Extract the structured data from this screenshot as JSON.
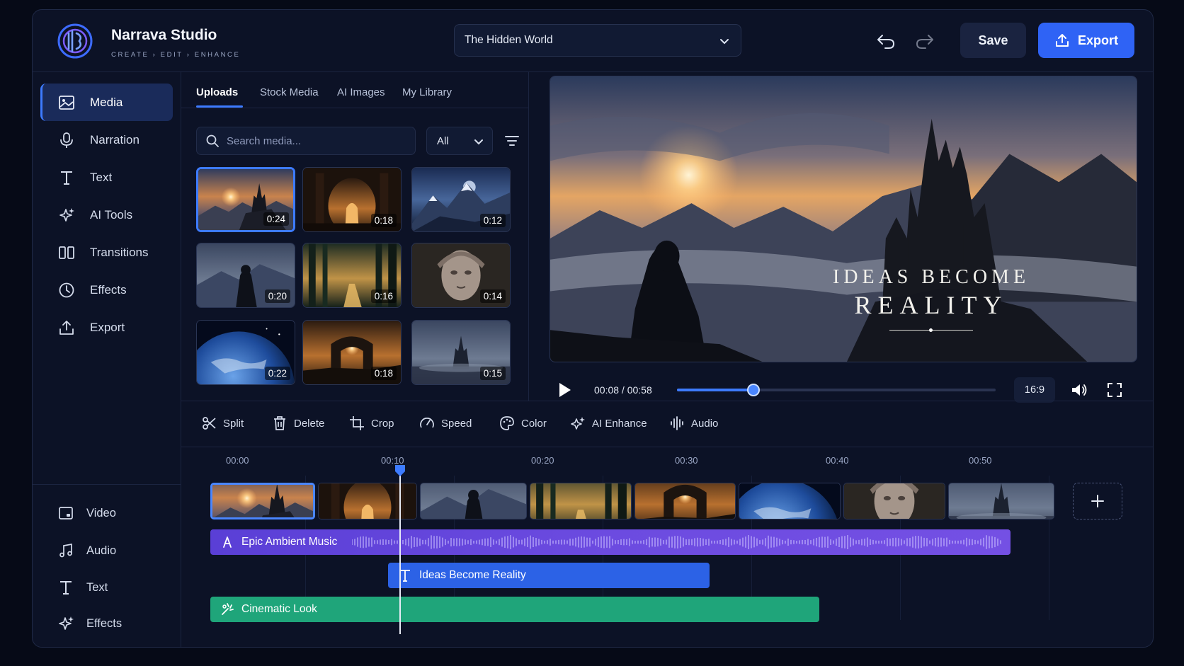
{
  "app": {
    "title": "Narrava Studio",
    "subtitle": "CREATE › EDIT › ENHANCE",
    "project": "The Hidden World",
    "save_label": "Save",
    "export_label": "Export"
  },
  "sidebar": {
    "items": [
      {
        "label": "Media",
        "icon": "image-icon",
        "active": true
      },
      {
        "label": "Narration",
        "icon": "microphone-icon"
      },
      {
        "label": "Text",
        "icon": "text-icon"
      },
      {
        "label": "AI Tools",
        "icon": "sparkle-icon"
      },
      {
        "label": "Transitions",
        "icon": "transitions-icon"
      },
      {
        "label": "Effects",
        "icon": "effects-icon"
      },
      {
        "label": "Export",
        "icon": "upload-icon"
      }
    ],
    "tracks": [
      {
        "label": "Video",
        "icon": "video-icon"
      },
      {
        "label": "Audio",
        "icon": "music-note-icon"
      },
      {
        "label": "Text",
        "icon": "text-icon"
      },
      {
        "label": "Effects",
        "icon": "sparkle-icon"
      }
    ]
  },
  "media": {
    "tabs": [
      "Uploads",
      "Stock Media",
      "AI Images",
      "My Library"
    ],
    "active_tab": "Uploads",
    "search_placeholder": "Search media...",
    "filter": "All",
    "thumbnails": [
      {
        "scene": "castle-sunset",
        "duration": "0:24",
        "selected": true
      },
      {
        "scene": "temple-interior",
        "duration": "0:18"
      },
      {
        "scene": "snowy-mountains",
        "duration": "0:12"
      },
      {
        "scene": "cloaked-figure",
        "duration": "0:20"
      },
      {
        "scene": "forest-stream",
        "duration": "0:16"
      },
      {
        "scene": "stone-statue",
        "duration": "0:14"
      },
      {
        "scene": "planet-earth",
        "duration": "0:22"
      },
      {
        "scene": "ruined-arches",
        "duration": "0:18"
      },
      {
        "scene": "misty-castle",
        "duration": "0:15"
      }
    ]
  },
  "preview": {
    "title_line1": "IDEAS BECOME",
    "title_line2": "REALITY",
    "timecode": "00:08 / 00:58",
    "progress": 0.24,
    "aspect_ratio": "16:9"
  },
  "toolbar": {
    "tools": [
      {
        "label": "Split",
        "icon": "scissors-icon"
      },
      {
        "label": "Delete",
        "icon": "trash-icon"
      },
      {
        "label": "Crop",
        "icon": "crop-icon"
      },
      {
        "label": "Speed",
        "icon": "speedometer-icon"
      },
      {
        "label": "Color",
        "icon": "palette-icon"
      },
      {
        "label": "AI Enhance",
        "icon": "sparkle-icon"
      },
      {
        "label": "Audio",
        "icon": "waveform-icon"
      }
    ]
  },
  "timeline": {
    "ticks": [
      "00:00",
      "00:10",
      "00:20",
      "00:30",
      "00:40",
      "00:50"
    ],
    "playhead_seconds": 11,
    "clips": [
      "castle-sunset",
      "temple-interior",
      "cloaked-figure",
      "forest-stream",
      "ruined-arches",
      "planet-earth",
      "stone-statue",
      "misty-castle"
    ],
    "music_label": "Epic Ambient Music",
    "text_label": "Ideas Become Reality",
    "look_label": "Cinematic Look"
  },
  "colors": {
    "accent": "#2f63f5",
    "music_track": "#6c4be0",
    "text_track": "#2c62e6",
    "effect_track": "#1fa57a"
  }
}
